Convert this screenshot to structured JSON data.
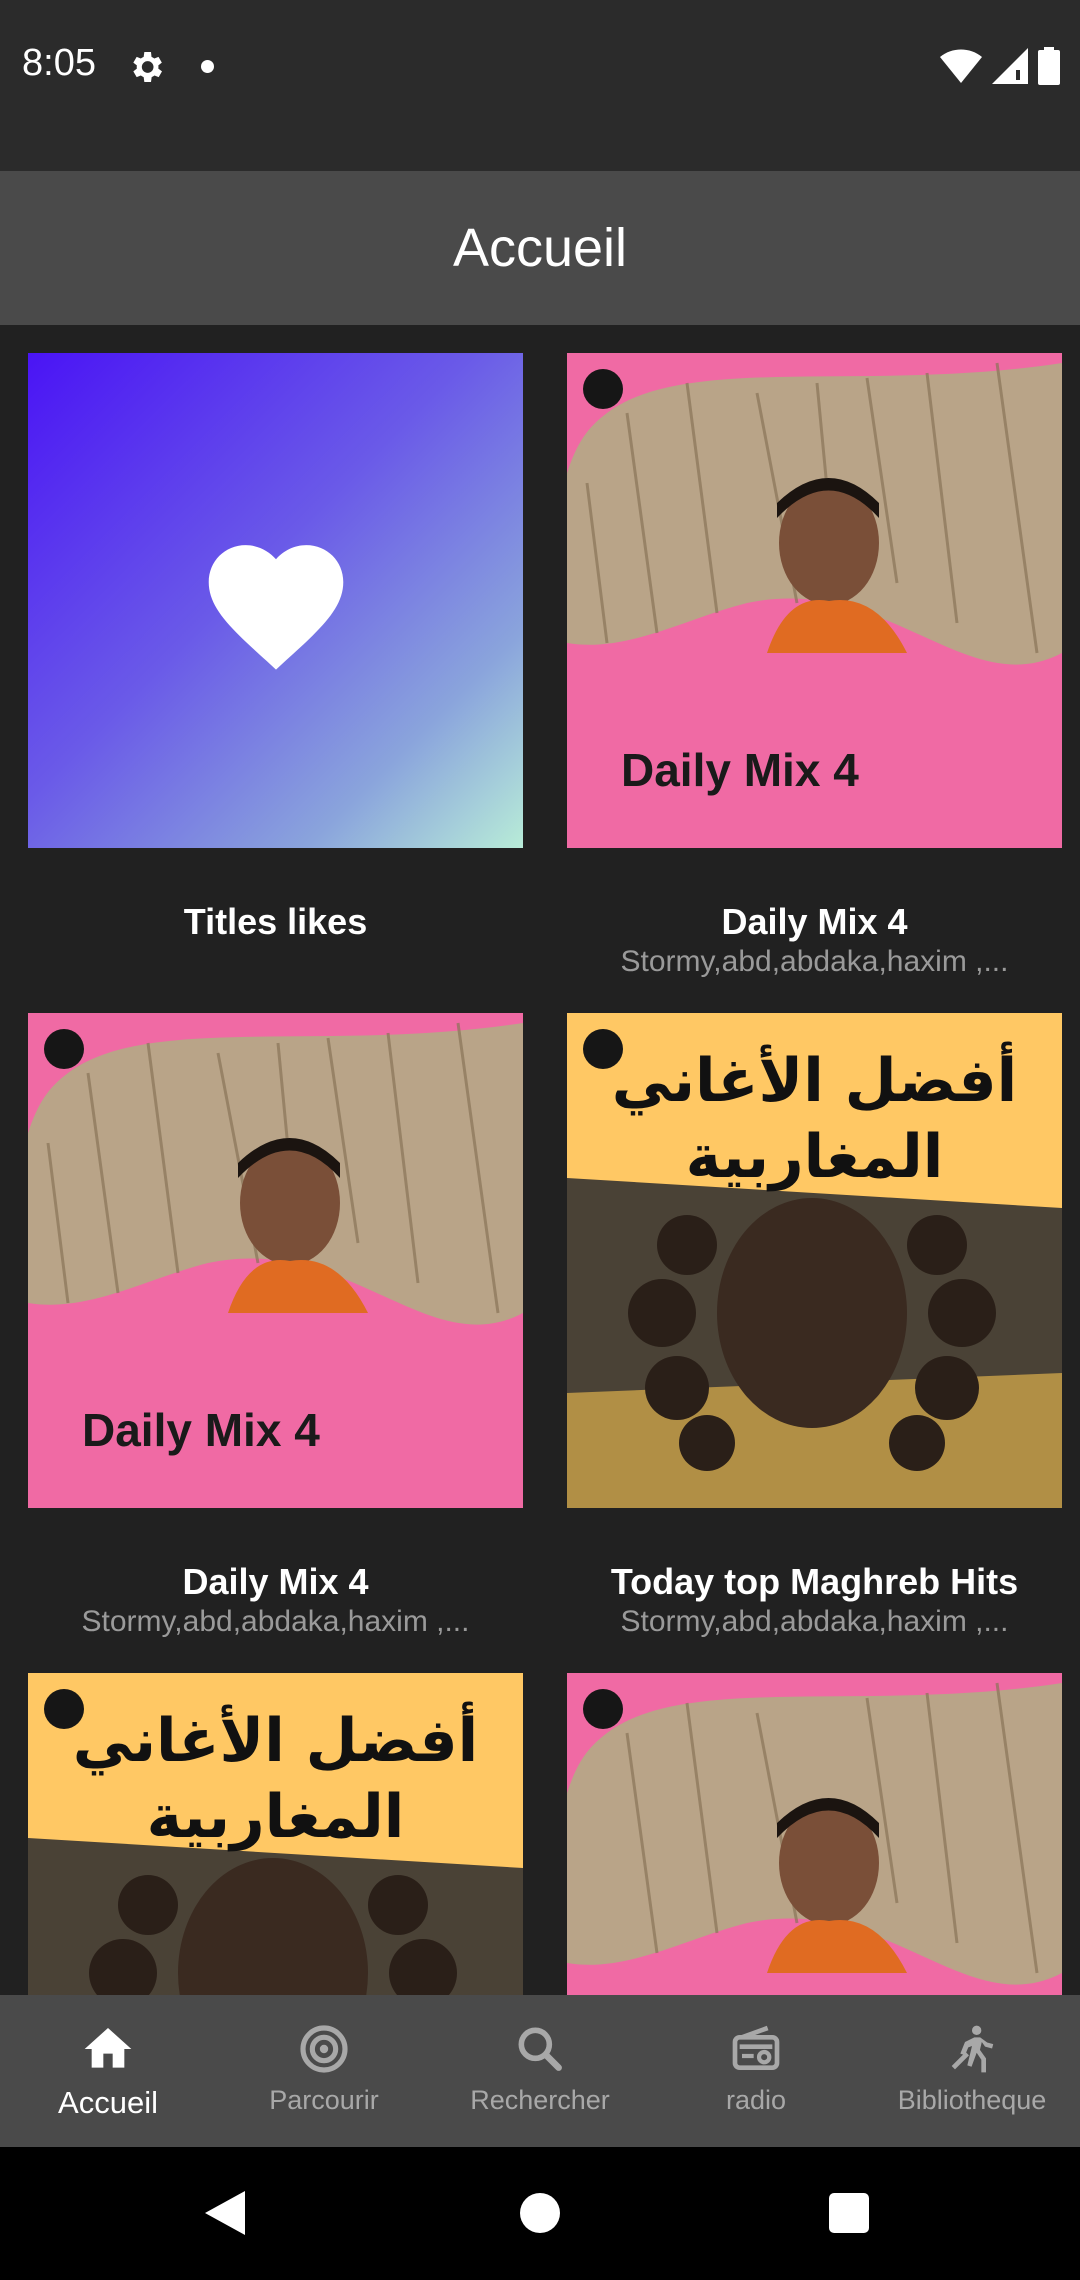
{
  "status_bar": {
    "time": "8:05",
    "icons": [
      "gear-icon",
      "notification-dot-icon",
      "wifi-icon",
      "cellular-signal-icon",
      "battery-icon"
    ]
  },
  "app_bar": {
    "title": "Accueil"
  },
  "cards": [
    {
      "title": "Titles likes",
      "subtitle": "",
      "cover": "liked-heart"
    },
    {
      "title": "Daily Mix 4",
      "subtitle": "Stormy,abd,abdaka,haxim ,...",
      "cover": "daily-mix",
      "cover_text": "Daily Mix 4"
    },
    {
      "title": "Daily Mix 4",
      "subtitle": "Stormy,abd,abdaka,haxim ,...",
      "cover": "daily-mix",
      "cover_text": "Daily Mix 4"
    },
    {
      "title": "Today top Maghreb Hits",
      "subtitle": "Stormy,abd,abdaka,haxim ,...",
      "cover": "maghreb",
      "cover_text": "أفضل الأغاني المغاربية"
    },
    {
      "title": "",
      "subtitle": "",
      "cover": "maghreb",
      "cover_text": "أفضل الأغاني المغاربية"
    },
    {
      "title": "",
      "subtitle": "",
      "cover": "daily-mix",
      "cover_text": ""
    }
  ],
  "bottom_nav": {
    "items": [
      {
        "label": "Accueil",
        "icon": "home-icon",
        "active": true
      },
      {
        "label": "Parcourir",
        "icon": "browse-icon",
        "active": false
      },
      {
        "label": "Rechercher",
        "icon": "search-icon",
        "active": false
      },
      {
        "label": "radio",
        "icon": "radio-icon",
        "active": false
      },
      {
        "label": "Bibliotheque",
        "icon": "library-icon",
        "active": false
      }
    ]
  },
  "colors": {
    "background": "#212121",
    "app_bar": "#4a4a4a",
    "status_bar": "#2b2b2b",
    "subtitle": "#9a9a9a",
    "daily_mix_pink": "#f06aa4",
    "maghreb_yellow": "#ffc864"
  }
}
